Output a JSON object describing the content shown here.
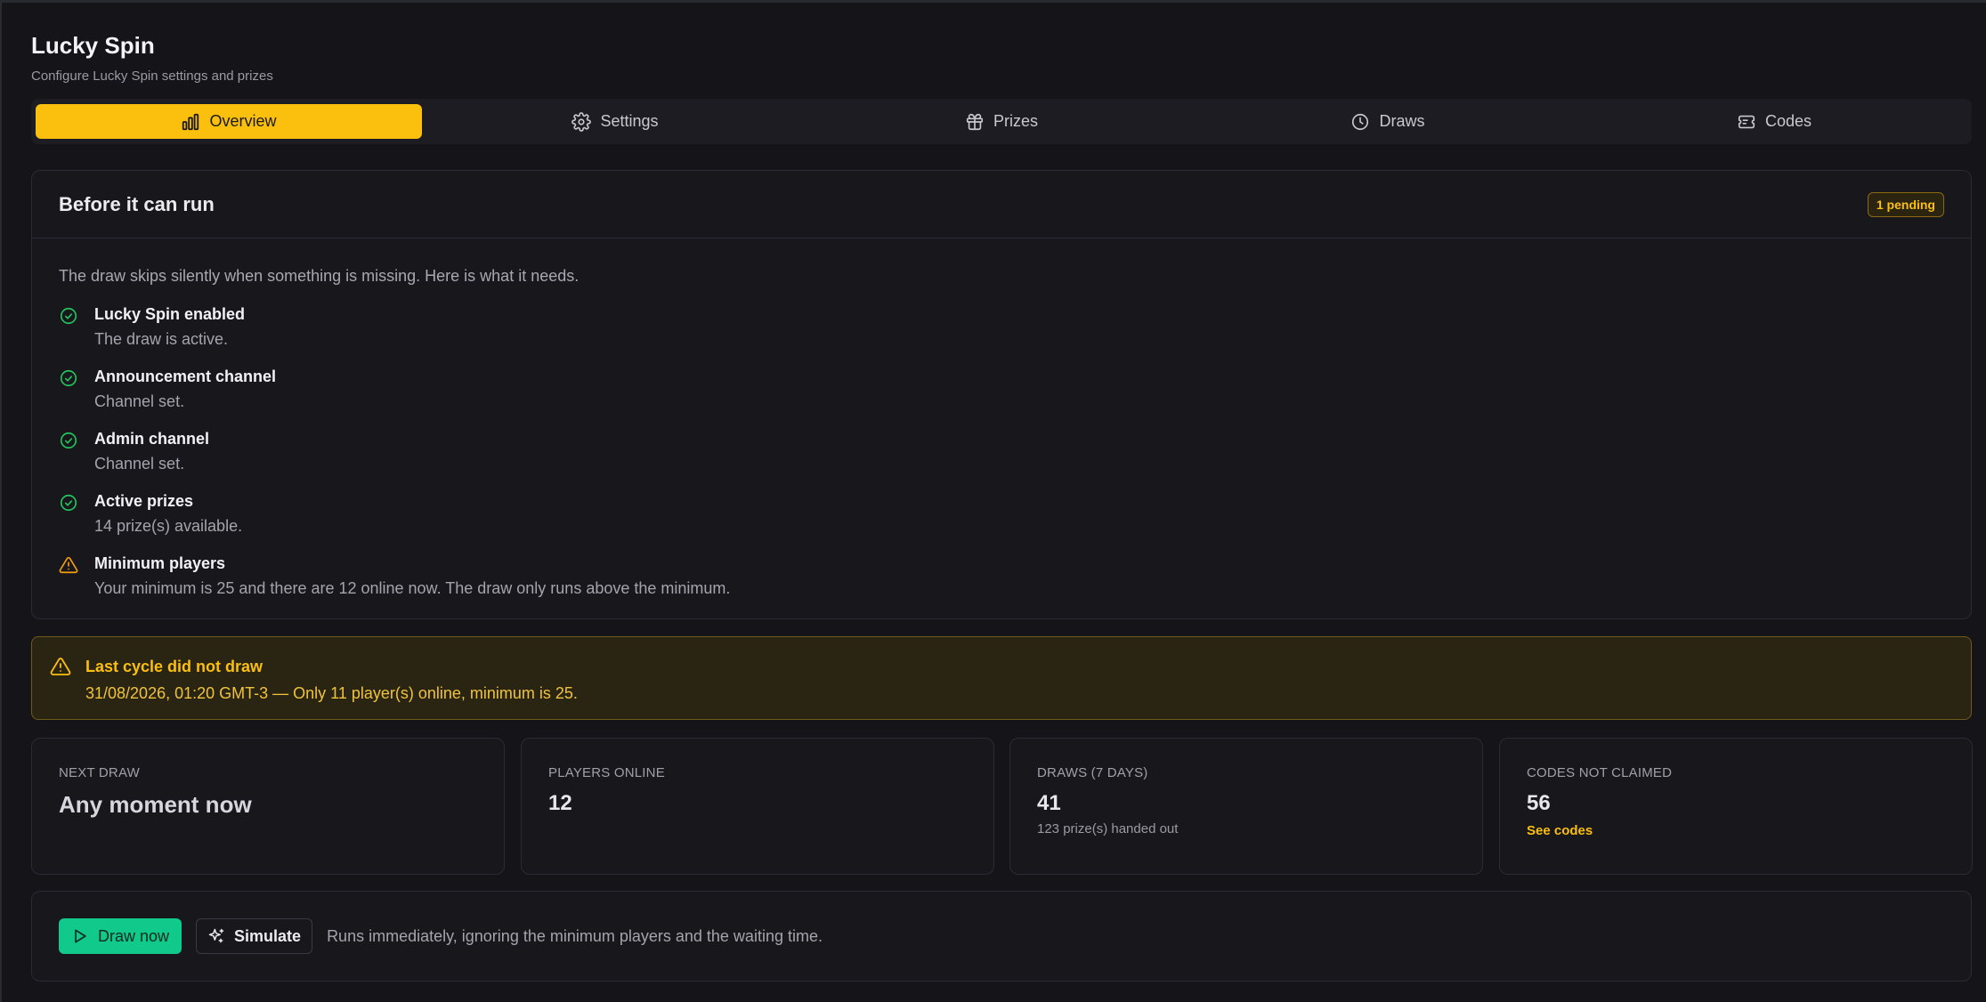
{
  "header": {
    "title": "Lucky Spin",
    "subtitle": "Configure Lucky Spin settings and prizes"
  },
  "tabs": [
    {
      "label": "Overview",
      "icon": "bar-chart-icon",
      "active": true
    },
    {
      "label": "Settings",
      "icon": "gear-icon",
      "active": false
    },
    {
      "label": "Prizes",
      "icon": "gift-icon",
      "active": false
    },
    {
      "label": "Draws",
      "icon": "clock-icon",
      "active": false
    },
    {
      "label": "Codes",
      "icon": "ticket-icon",
      "active": false
    }
  ],
  "checklist": {
    "title": "Before it can run",
    "badge": "1 pending",
    "lead": "The draw skips silently when something is missing. Here is what it needs.",
    "items": [
      {
        "title": "Lucky Spin enabled",
        "desc": "The draw is active.",
        "status": "ok"
      },
      {
        "title": "Announcement channel",
        "desc": "Channel set.",
        "status": "ok"
      },
      {
        "title": "Admin channel",
        "desc": "Channel set.",
        "status": "ok"
      },
      {
        "title": "Active prizes",
        "desc": "14 prize(s) available.",
        "status": "ok"
      },
      {
        "title": "Minimum players",
        "desc": "Your minimum is 25 and there are 12 online now. The draw only runs above the minimum.",
        "status": "warning"
      }
    ]
  },
  "alert": {
    "title": "Last cycle did not draw",
    "text": "31/08/2026, 01:20 GMT-3 — Only 11 player(s) online, minimum is 25."
  },
  "stats": {
    "next_draw": {
      "label": "NEXT DRAW",
      "value": "Any moment now"
    },
    "players_online": {
      "label": "PLAYERS ONLINE",
      "value": "12"
    },
    "draws_7_days": {
      "label": "DRAWS (7 DAYS)",
      "value": "41",
      "sub": "123 prize(s) handed out"
    },
    "codes_not_claimed": {
      "label": "CODES NOT CLAIMED",
      "value": "56",
      "link": "See codes"
    }
  },
  "actions": {
    "draw_now": "Draw now",
    "simulate": "Simulate",
    "note": "Runs immediately, ignoring the minimum players and the waiting time."
  },
  "colors": {
    "accent": "#fbbf0e",
    "success": "#10c98a",
    "background": "#141419",
    "card": "#17171c"
  }
}
